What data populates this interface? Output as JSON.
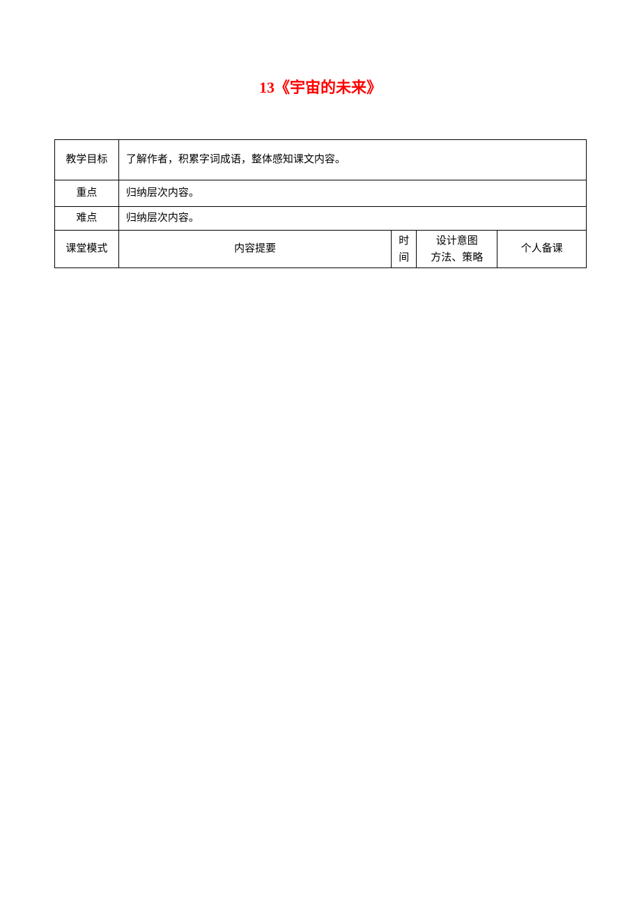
{
  "title": "13《宇宙的未来》",
  "rows": {
    "objective": {
      "label": "教学目标",
      "value": "了解作者，积累字词成语，整体感知课文内容。"
    },
    "focus": {
      "label": "重点",
      "value": "归纳层次内容。"
    },
    "difficulty": {
      "label": "难点",
      "value": "归纳层次内容。"
    }
  },
  "headers": {
    "col1": "课堂模式",
    "col2": "内容提要",
    "col3_line1": "时",
    "col3_line2": "间",
    "col4_line1": "设计意图",
    "col4_line2": "方法、策略",
    "col5": "个人备课"
  }
}
